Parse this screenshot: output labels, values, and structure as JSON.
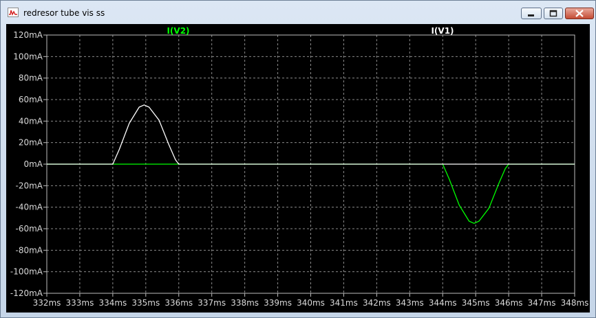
{
  "window": {
    "title": "redresor tube vis ss",
    "icon": "waveform-plot-icon",
    "controls": [
      "minimize-icon",
      "maximize-icon",
      "close-icon"
    ]
  },
  "colors": {
    "background": "#000000",
    "grid": "#8c8c8c",
    "axis_text": "#d9d9d9",
    "trace_v2": "#00ff00",
    "trace_v1": "#ffffff"
  },
  "chart_data": {
    "type": "line",
    "title": "",
    "xlabel": "",
    "ylabel": "",
    "xlim": [
      332,
      348
    ],
    "ylim": [
      -120,
      120
    ],
    "grid": true,
    "x_ticks": [
      332,
      333,
      334,
      335,
      336,
      337,
      338,
      339,
      340,
      341,
      342,
      343,
      344,
      345,
      346,
      347,
      348
    ],
    "x_tick_labels": [
      "332ms",
      "333ms",
      "334ms",
      "335ms",
      "336ms",
      "337ms",
      "338ms",
      "339ms",
      "340ms",
      "341ms",
      "342ms",
      "343ms",
      "344ms",
      "345ms",
      "346ms",
      "347ms",
      "348ms"
    ],
    "y_ticks": [
      120,
      100,
      80,
      60,
      40,
      20,
      0,
      -20,
      -40,
      -60,
      -80,
      -100,
      -120
    ],
    "y_tick_labels": [
      "120mA",
      "100mA",
      "80mA",
      "60mA",
      "40mA",
      "20mA",
      "0mA",
      "-20mA",
      "-40mA",
      "-60mA",
      "-80mA",
      "-100mA",
      "-120mA"
    ],
    "series": [
      {
        "name": "I(V2)",
        "color": "#00ff00",
        "x": [
          332,
          344,
          344.2,
          344.5,
          344.8,
          344.95,
          345.1,
          345.4,
          345.7,
          345.9,
          346,
          348
        ],
        "y": [
          0,
          0,
          -14,
          -38,
          -53,
          -55,
          -53,
          -41,
          -18,
          -4,
          0,
          0
        ]
      },
      {
        "name": "I(V1)",
        "color": "#ffffff",
        "x": [
          332,
          334,
          334.2,
          334.5,
          334.8,
          334.95,
          335.1,
          335.4,
          335.7,
          335.9,
          336,
          348
        ],
        "y": [
          0,
          0,
          14,
          38,
          53,
          55,
          53,
          41,
          18,
          4,
          0,
          0
        ]
      }
    ]
  }
}
